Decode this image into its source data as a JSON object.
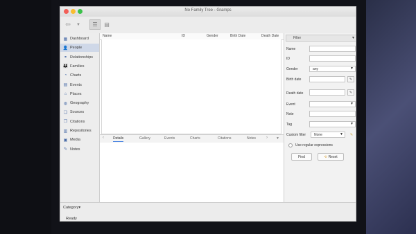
{
  "window": {
    "title": "No Family Tree - Gramps"
  },
  "sidebar": {
    "items": [
      {
        "label": "Dashboard",
        "icon": "dashboard-icon",
        "glyph": "▦",
        "active": false
      },
      {
        "label": "People",
        "icon": "person-icon",
        "glyph": "👤",
        "active": true
      },
      {
        "label": "Relationships",
        "icon": "relationships-icon",
        "glyph": "⚭",
        "active": false
      },
      {
        "label": "Families",
        "icon": "families-icon",
        "glyph": "👪",
        "active": false
      },
      {
        "label": "Charts",
        "icon": "charts-icon",
        "glyph": "◔",
        "active": false
      },
      {
        "label": "Events",
        "icon": "events-icon",
        "glyph": "▤",
        "active": false
      },
      {
        "label": "Places",
        "icon": "places-icon",
        "glyph": "⌂",
        "active": false
      },
      {
        "label": "Geography",
        "icon": "geography-icon",
        "glyph": "◍",
        "active": false
      },
      {
        "label": "Sources",
        "icon": "sources-icon",
        "glyph": "❏",
        "active": false
      },
      {
        "label": "Citations",
        "icon": "citations-icon",
        "glyph": "❐",
        "active": false
      },
      {
        "label": "Repositories",
        "icon": "repositories-icon",
        "glyph": "▥",
        "active": false
      },
      {
        "label": "Media",
        "icon": "media-icon",
        "glyph": "▣",
        "active": false
      },
      {
        "label": "Notes",
        "icon": "notes-icon",
        "glyph": "✎",
        "active": false
      }
    ],
    "category_label": "Category"
  },
  "people_list": {
    "columns": [
      "Name",
      "ID",
      "Gender",
      "Birth Date",
      "Death Date"
    ]
  },
  "bottom_tabs": [
    "Details",
    "Gallery",
    "Events",
    "Charts",
    "Citations",
    "Notes"
  ],
  "filter": {
    "header": "Filter",
    "name_label": "Name",
    "id_label": "ID",
    "gender_label": "Gender",
    "gender_value": "any",
    "birth_label": "Birth date",
    "death_label": "Death date",
    "event_label": "Event",
    "note_label": "Note",
    "tag_label": "Tag",
    "custom_filter_label": "Custom filter",
    "custom_filter_value": "None",
    "regex_label": "Use regular expressions",
    "find_label": "Find",
    "reset_label": "Reset"
  },
  "status": {
    "text": "Ready"
  }
}
